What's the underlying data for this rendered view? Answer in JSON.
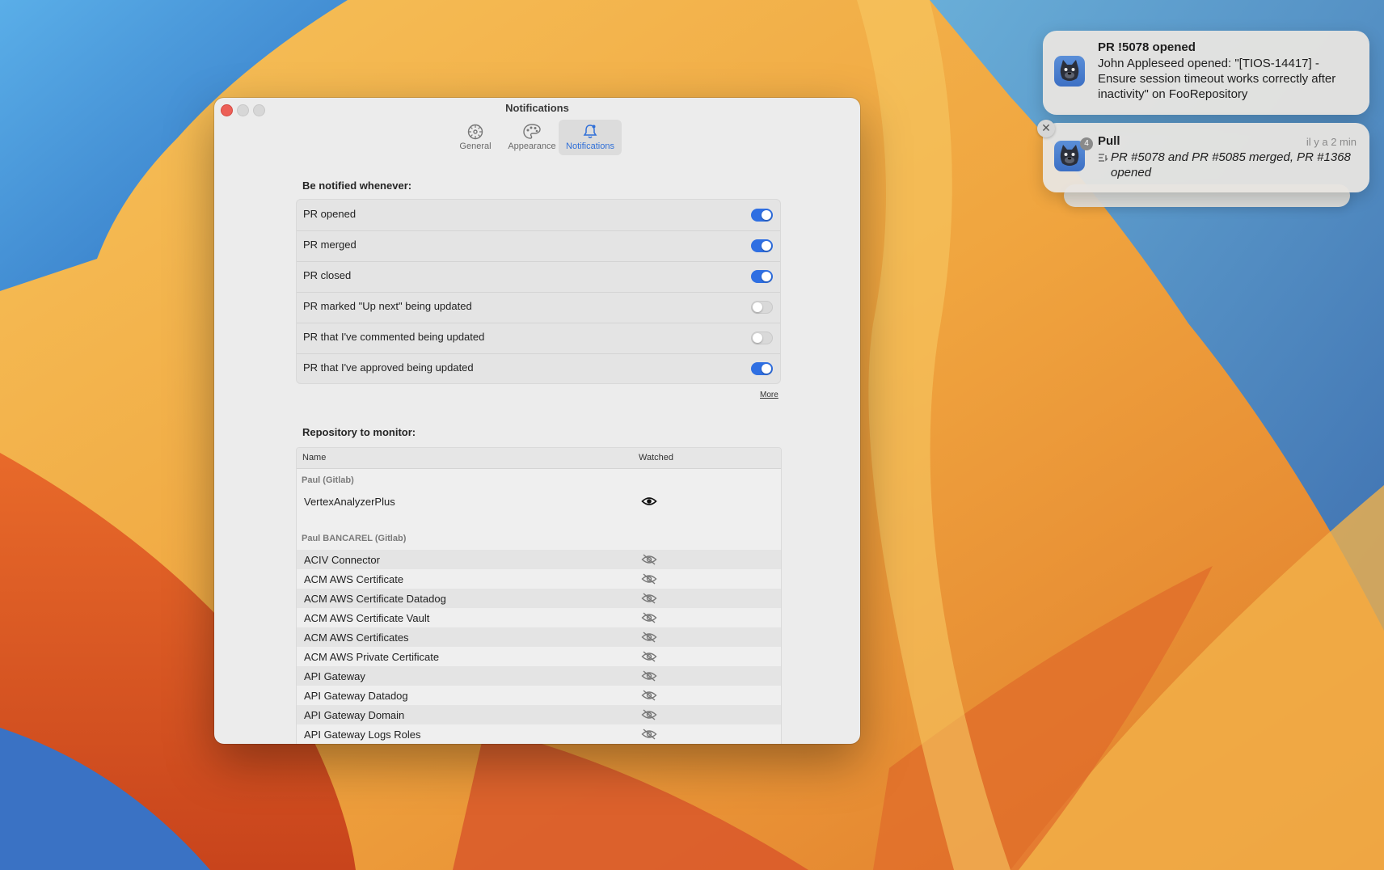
{
  "window": {
    "title": "Notifications",
    "tabs": [
      {
        "label": "General",
        "icon": "gear-icon"
      },
      {
        "label": "Appearance",
        "icon": "palette-icon"
      },
      {
        "label": "Notifications",
        "icon": "bell-icon",
        "selected": true
      }
    ]
  },
  "notify": {
    "heading": "Be notified whenever:",
    "options": [
      {
        "label": "PR opened",
        "enabled": true
      },
      {
        "label": "PR merged",
        "enabled": true
      },
      {
        "label": "PR closed",
        "enabled": true
      },
      {
        "label": "PR marked \"Up next\" being updated",
        "enabled": false
      },
      {
        "label": "PR that I've commented being updated",
        "enabled": false
      },
      {
        "label": "PR that I've approved being updated",
        "enabled": true
      }
    ],
    "more_label": "More"
  },
  "repos": {
    "heading": "Repository to monitor:",
    "columns": {
      "name": "Name",
      "watched": "Watched"
    },
    "groups": [
      {
        "label": "Paul (Gitlab)",
        "items": [
          {
            "name": "VertexAnalyzerPlus",
            "watched": true
          }
        ]
      },
      {
        "label": "Paul BANCAREL (Gitlab)",
        "items": [
          {
            "name": "ACIV Connector",
            "watched": false
          },
          {
            "name": "ACM AWS Certificate",
            "watched": false
          },
          {
            "name": "ACM AWS Certificate Datadog",
            "watched": false
          },
          {
            "name": "ACM AWS Certificate Vault",
            "watched": false
          },
          {
            "name": "ACM AWS Certificates",
            "watched": false
          },
          {
            "name": "ACM AWS Private Certificate",
            "watched": false
          },
          {
            "name": "API Gateway",
            "watched": false
          },
          {
            "name": "API Gateway Datadog",
            "watched": false
          },
          {
            "name": "API Gateway Domain",
            "watched": false
          },
          {
            "name": "API Gateway Logs Roles",
            "watched": false
          }
        ]
      }
    ]
  },
  "notifications": [
    {
      "title": "PR !5078 opened",
      "body": "John Appleseed opened: \"[TIOS-14417] - Ensure session timeout works correctly after inactivity\" on FooRepository"
    },
    {
      "title": "Pull",
      "time": "il y a 2 min",
      "body": "PR #5078 and PR #5085 merged, PR #1368 opened",
      "badge": "4"
    }
  ],
  "colors": {
    "accent": "#2f6fe2",
    "close": "#ec5f57"
  }
}
